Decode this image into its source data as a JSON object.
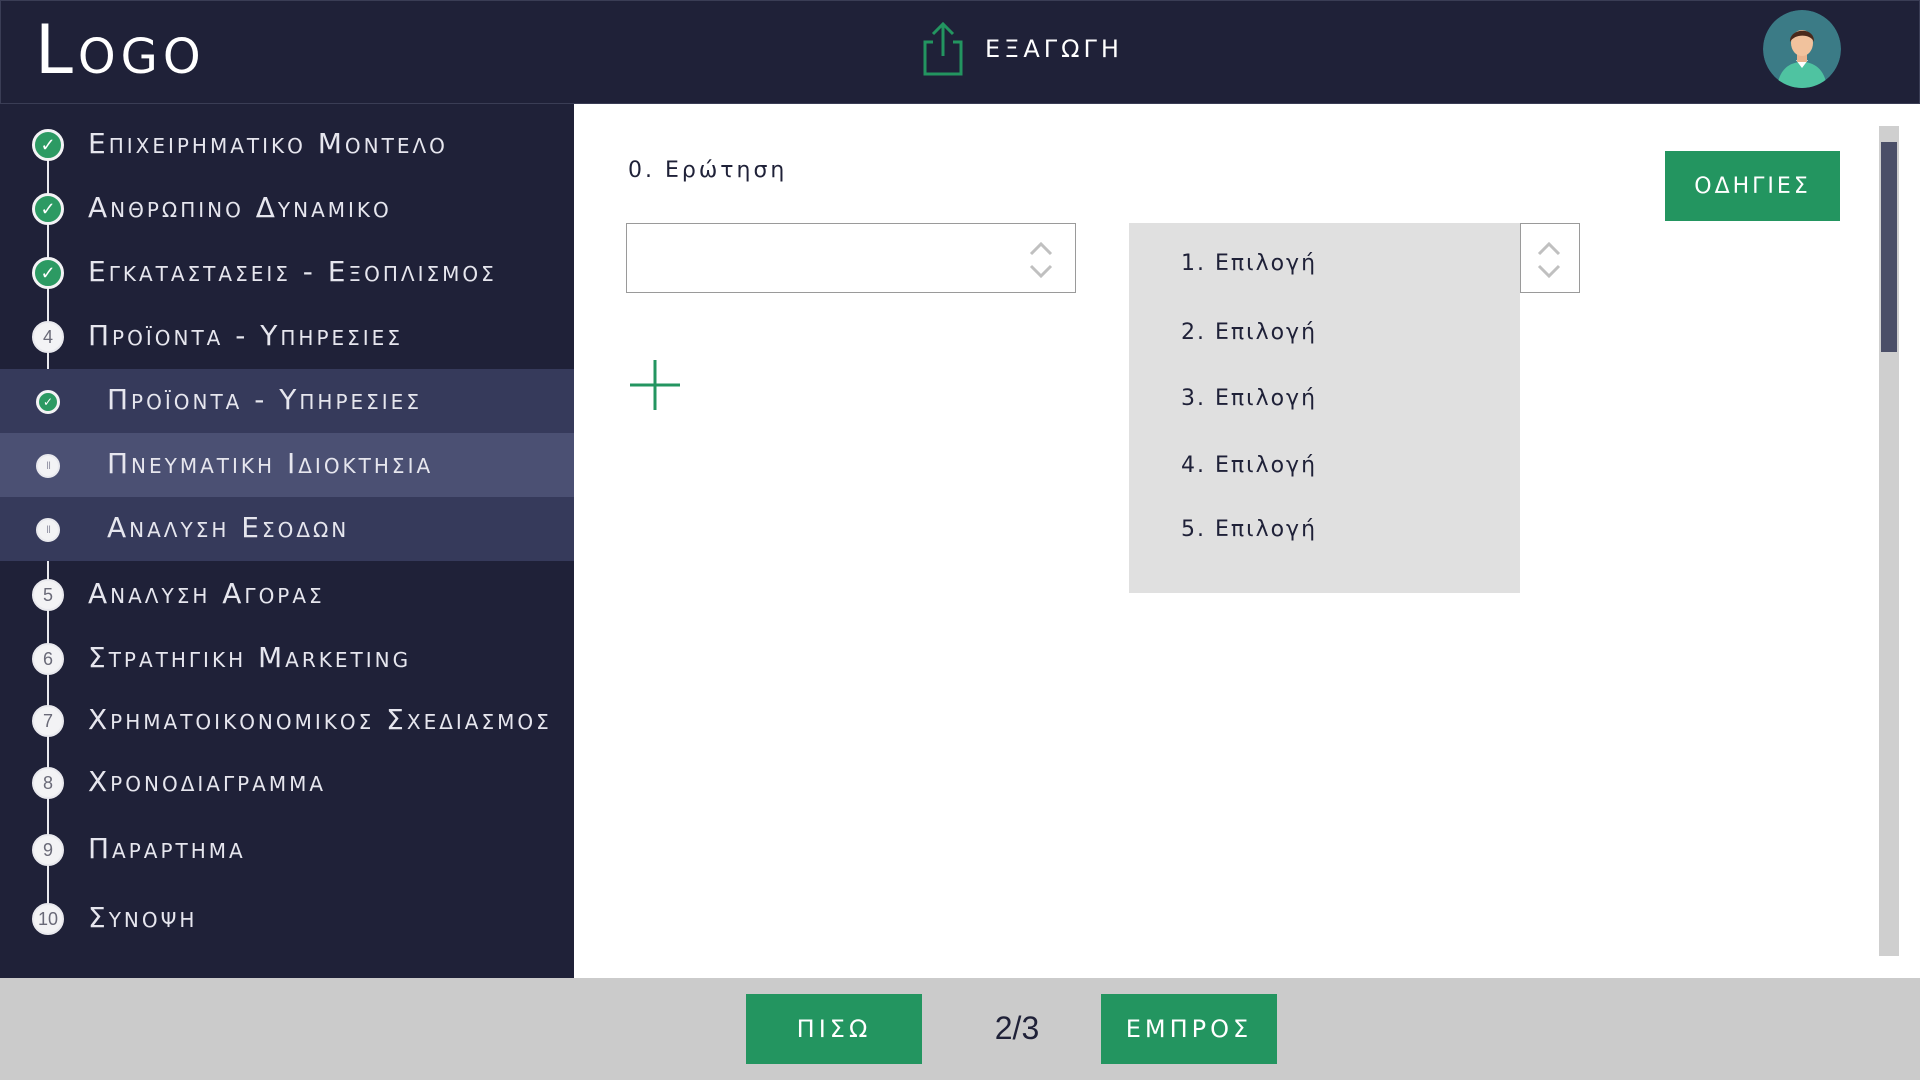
{
  "header": {
    "logo": "Logo",
    "export_label": "ΕΞΑΓΩΓΗ",
    "export_icon": "share-upload-icon",
    "avatar_icon": "user-avatar-icon"
  },
  "colors": {
    "dark_navy": "#1f2138",
    "accent_green": "#239560",
    "sub_item_bg": "#363a5b",
    "active_item_bg": "#4b5073",
    "dropdown_bg": "#e0e0e0",
    "footer_bg": "#cbcbcb"
  },
  "sidebar": {
    "items": [
      {
        "marker": "✓",
        "state": "done",
        "label": "Επιχειρηματικο Μοντελο"
      },
      {
        "marker": "✓",
        "state": "done",
        "label": "Ανθρωπινο Δυναμικο"
      },
      {
        "marker": "✓",
        "state": "done",
        "label": "Εγκαταστασεις - Εξοπλισμος"
      },
      {
        "marker": "4",
        "state": "pending",
        "label": "Προϊοντα - Υπηρεσιες"
      },
      {
        "marker": "✓",
        "state": "done",
        "label": "Προϊοντα - Υπηρεσιες"
      },
      {
        "marker": "II",
        "state": "current",
        "label": "Πνευματικη Ιδιοκτησια"
      },
      {
        "marker": "II",
        "state": "paused",
        "label": "Αναλυση Εσοδων"
      },
      {
        "marker": "5",
        "state": "pending",
        "label": "Αναλυση Αγορας"
      },
      {
        "marker": "6",
        "state": "pending",
        "label": "Στρατηγικη Marketing"
      },
      {
        "marker": "7",
        "state": "pending",
        "label": "Χρηματοικονομικος Σχεδιασμος"
      },
      {
        "marker": "8",
        "state": "pending",
        "label": "Χρονοδιαγραμμα"
      },
      {
        "marker": "9",
        "state": "pending",
        "label": "Παραρτημα"
      },
      {
        "marker": "10",
        "state": "pending",
        "label": "Συνοψη"
      }
    ]
  },
  "main": {
    "question_label": "0. Ερώτηση",
    "select_left_value": "",
    "dropdown_options": [
      "1. Επιλογή",
      "2. Επιλογή",
      "3. Επιλογή",
      "4. Επιλογή",
      "5. Επιλογή"
    ],
    "add_icon": "plus-icon",
    "guide_button": "ΟΔΗΓΙΕΣ"
  },
  "footer": {
    "back_label": "ΠΙΣΩ",
    "page_indicator": "2/3",
    "next_label": "ΕΜΠΡΟΣ"
  }
}
